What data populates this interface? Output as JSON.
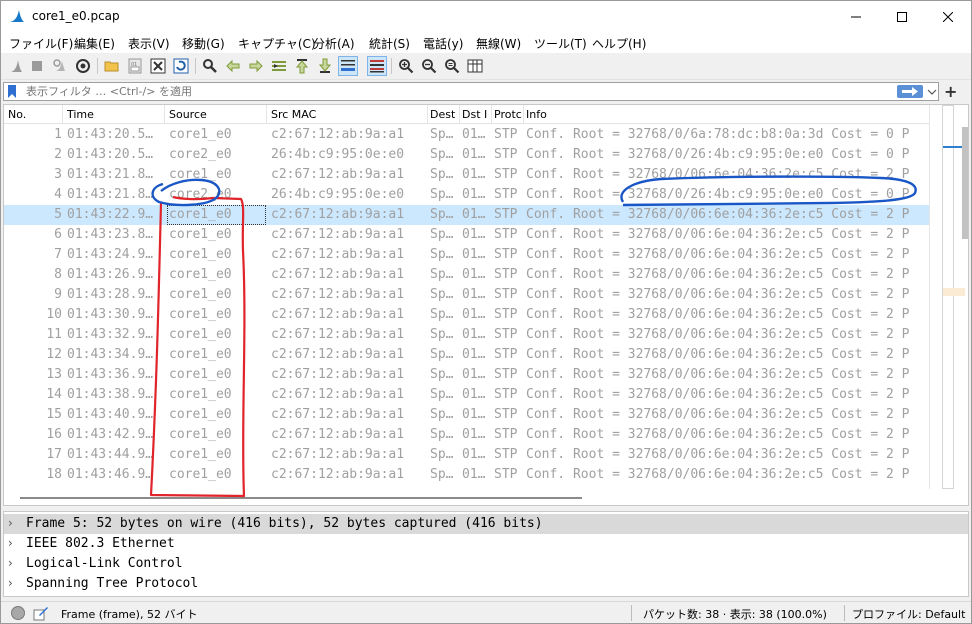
{
  "window": {
    "title": "core1_e0.pcap"
  },
  "menu": [
    "ファイル(F)",
    "編集(E)",
    "表示(V)",
    "移動(G)",
    "キャプチャ(C)",
    "分析(A)",
    "統計(S)",
    "電話(y)",
    "無線(W)",
    "ツール(T)",
    "ヘルプ(H)"
  ],
  "toolbar": {
    "icons": [
      "start-capture-icon",
      "stop-capture-icon",
      "restart-capture-icon",
      "capture-options-icon",
      "open-file-icon",
      "save-file-icon",
      "close-file-icon",
      "reload-file-icon",
      "find-packet-icon",
      "go-back-icon",
      "go-forward-icon",
      "go-to-packet-icon",
      "go-first-icon",
      "go-last-icon",
      "autoscroll-icon",
      "colorize-icon",
      "zoom-in-icon",
      "zoom-out-icon",
      "zoom-normal-icon",
      "resize-columns-icon"
    ]
  },
  "filter": {
    "placeholder": "表示フィルタ … <Ctrl-/> を適用"
  },
  "columns": [
    "No.",
    "Time",
    "Source",
    "Src MAC",
    "Dest",
    "Dst I",
    "Protc",
    "Info"
  ],
  "packets": [
    {
      "no": "1",
      "time": "01:43:20.5…",
      "src": "core1_e0",
      "mac": "c2:67:12:ab:9a:a1",
      "dest": "Sp…",
      "dsti": "01…",
      "proto": "STP",
      "info": "Conf. Root = 32768/0/6a:78:dc:b8:0a:3d  Cost = 0  P"
    },
    {
      "no": "2",
      "time": "01:43:20.5…",
      "src": "core2_e0",
      "mac": "26:4b:c9:95:0e:e0",
      "dest": "Sp…",
      "dsti": "01…",
      "proto": "STP",
      "info": "Conf. Root = 32768/0/26:4b:c9:95:0e:e0  Cost = 0  P"
    },
    {
      "no": "3",
      "time": "01:43:21.8…",
      "src": "core1_e0",
      "mac": "c2:67:12:ab:9a:a1",
      "dest": "Sp…",
      "dsti": "01…",
      "proto": "STP",
      "info": "Conf. Root = 32768/0/06:6e:04:36:2e:c5  Cost = 2  P"
    },
    {
      "no": "4",
      "time": "01:43:21.8…",
      "src": "core2_e0",
      "mac": "26:4b:c9:95:0e:e0",
      "dest": "Sp…",
      "dsti": "01…",
      "proto": "STP",
      "info": "Conf. Root = 32768/0/26:4b:c9:95:0e:e0  Cost = 0  P"
    },
    {
      "no": "5",
      "time": "01:43:22.9…",
      "src": "core1_e0",
      "mac": "c2:67:12:ab:9a:a1",
      "dest": "Sp…",
      "dsti": "01…",
      "proto": "STP",
      "info": "Conf. Root = 32768/0/06:6e:04:36:2e:c5  Cost = 2  P"
    },
    {
      "no": "6",
      "time": "01:43:23.8…",
      "src": "core1_e0",
      "mac": "c2:67:12:ab:9a:a1",
      "dest": "Sp…",
      "dsti": "01…",
      "proto": "STP",
      "info": "Conf. Root = 32768/0/06:6e:04:36:2e:c5  Cost = 2  P"
    },
    {
      "no": "7",
      "time": "01:43:24.9…",
      "src": "core1_e0",
      "mac": "c2:67:12:ab:9a:a1",
      "dest": "Sp…",
      "dsti": "01…",
      "proto": "STP",
      "info": "Conf. Root = 32768/0/06:6e:04:36:2e:c5  Cost = 2  P"
    },
    {
      "no": "8",
      "time": "01:43:26.9…",
      "src": "core1_e0",
      "mac": "c2:67:12:ab:9a:a1",
      "dest": "Sp…",
      "dsti": "01…",
      "proto": "STP",
      "info": "Conf. Root = 32768/0/06:6e:04:36:2e:c5  Cost = 2  P"
    },
    {
      "no": "9",
      "time": "01:43:28.9…",
      "src": "core1_e0",
      "mac": "c2:67:12:ab:9a:a1",
      "dest": "Sp…",
      "dsti": "01…",
      "proto": "STP",
      "info": "Conf. Root = 32768/0/06:6e:04:36:2e:c5  Cost = 2  P"
    },
    {
      "no": "10",
      "time": "01:43:30.9…",
      "src": "core1_e0",
      "mac": "c2:67:12:ab:9a:a1",
      "dest": "Sp…",
      "dsti": "01…",
      "proto": "STP",
      "info": "Conf. Root = 32768/0/06:6e:04:36:2e:c5  Cost = 2  P"
    },
    {
      "no": "11",
      "time": "01:43:32.9…",
      "src": "core1_e0",
      "mac": "c2:67:12:ab:9a:a1",
      "dest": "Sp…",
      "dsti": "01…",
      "proto": "STP",
      "info": "Conf. Root = 32768/0/06:6e:04:36:2e:c5  Cost = 2  P"
    },
    {
      "no": "12",
      "time": "01:43:34.9…",
      "src": "core1_e0",
      "mac": "c2:67:12:ab:9a:a1",
      "dest": "Sp…",
      "dsti": "01…",
      "proto": "STP",
      "info": "Conf. Root = 32768/0/06:6e:04:36:2e:c5  Cost = 2  P"
    },
    {
      "no": "13",
      "time": "01:43:36.9…",
      "src": "core1_e0",
      "mac": "c2:67:12:ab:9a:a1",
      "dest": "Sp…",
      "dsti": "01…",
      "proto": "STP",
      "info": "Conf. Root = 32768/0/06:6e:04:36:2e:c5  Cost = 2  P"
    },
    {
      "no": "14",
      "time": "01:43:38.9…",
      "src": "core1_e0",
      "mac": "c2:67:12:ab:9a:a1",
      "dest": "Sp…",
      "dsti": "01…",
      "proto": "STP",
      "info": "Conf. Root = 32768/0/06:6e:04:36:2e:c5  Cost = 2  P"
    },
    {
      "no": "15",
      "time": "01:43:40.9…",
      "src": "core1_e0",
      "mac": "c2:67:12:ab:9a:a1",
      "dest": "Sp…",
      "dsti": "01…",
      "proto": "STP",
      "info": "Conf. Root = 32768/0/06:6e:04:36:2e:c5  Cost = 2  P"
    },
    {
      "no": "16",
      "time": "01:43:42.9…",
      "src": "core1_e0",
      "mac": "c2:67:12:ab:9a:a1",
      "dest": "Sp…",
      "dsti": "01…",
      "proto": "STP",
      "info": "Conf. Root = 32768/0/06:6e:04:36:2e:c5  Cost = 2  P"
    },
    {
      "no": "17",
      "time": "01:43:44.9…",
      "src": "core1_e0",
      "mac": "c2:67:12:ab:9a:a1",
      "dest": "Sp…",
      "dsti": "01…",
      "proto": "STP",
      "info": "Conf. Root = 32768/0/06:6e:04:36:2e:c5  Cost = 2  P"
    },
    {
      "no": "18",
      "time": "01:43:46.9…",
      "src": "core1_e0",
      "mac": "c2:67:12:ab:9a:a1",
      "dest": "Sp…",
      "dsti": "01…",
      "proto": "STP",
      "info": "Conf. Root = 32768/0/06:6e:04:36:2e:c5  Cost = 2  P"
    }
  ],
  "selected_packet": "5",
  "details": [
    "Frame 5: 52 bytes on wire (416 bits), 52 bytes captured (416 bits)",
    "IEEE 802.3 Ethernet",
    "Logical-Link Control",
    "Spanning Tree Protocol"
  ],
  "status": {
    "frame": "Frame (frame), 52 バイト",
    "packets": "パケット数: 38 · 表示: 38 (100.0%)",
    "profile": "プロファイル: Default"
  },
  "colors": {
    "selected_row": "#cce8ff",
    "annotation_red": "#e0242a",
    "annotation_blue": "#1a57c6"
  }
}
